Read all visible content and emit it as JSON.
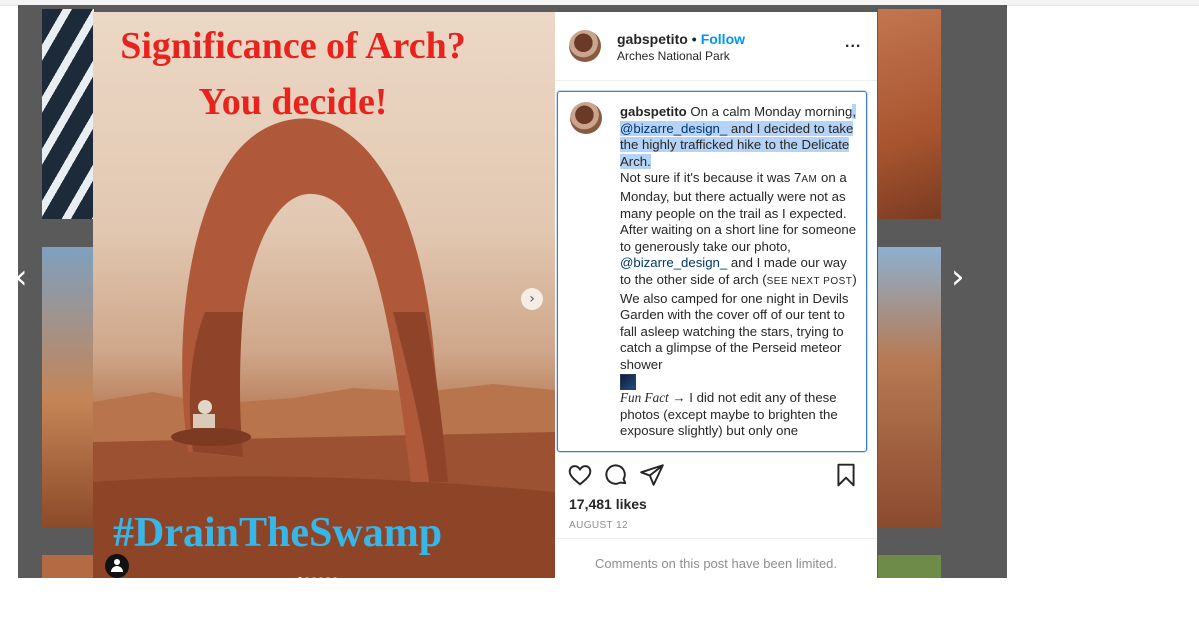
{
  "post": {
    "overlay_title_line1": "Significance of Arch?",
    "overlay_title_line2": "You decide!",
    "overlay_hashtag": "#DrainTheSwamp",
    "carousel_next_glyph": "›",
    "carousel_slide_count": 6,
    "carousel_active_index": 0
  },
  "navigation": {
    "prev_glyph": "‹",
    "next_glyph": "›"
  },
  "header": {
    "username": "gabspetito",
    "separator": "•",
    "follow_label": "Follow",
    "location": "Arches National Park",
    "more_label": "..."
  },
  "caption": {
    "username": "gabspetito",
    "t1": "On a calm Monday morning",
    "t2": ", ",
    "mention1": "@bizarre_design_",
    "t3": " and I decided to take the highly trafficked hike to the Delicate Arch.",
    "t4": "Not sure if it's because it was 7",
    "t4_small": "AM",
    "t5": " on a Monday, but there actually were not as many people on the trail as I expected. After waiting on a short line for someone to generously take our photo, ",
    "mention2": "@bizarre_design_",
    "t6": " and I made our way to the other side of arch (",
    "t6_small": "SEE NEXT POST",
    "t7": ")",
    "t8": "We also camped for one night in Devils Garden with the cover off of our tent to fall asleep watching the stars, trying to catch a glimpse of the Perseid meteor shower",
    "fun_fact_label": "Fun Fact",
    "arrow": "→",
    "t9": " I did not edit any of these photos (except maybe to brighten the exposure slightly) but only one"
  },
  "actions": {
    "likes": "17,481 likes",
    "date": "AUGUST 12"
  },
  "comments": {
    "limited_text": "Comments on this post have been limited."
  },
  "colors": {
    "follow": "#0095f6",
    "highlight": "#b4d3f7",
    "mention": "#00376b",
    "overlay_red": "#e8231e",
    "overlay_blue": "#37b6e8"
  },
  "icons": [
    "chevron-left-icon",
    "chevron-right-icon",
    "heart-icon",
    "comment-icon",
    "share-icon",
    "bookmark-icon",
    "more-icon",
    "user-tag-icon"
  ]
}
